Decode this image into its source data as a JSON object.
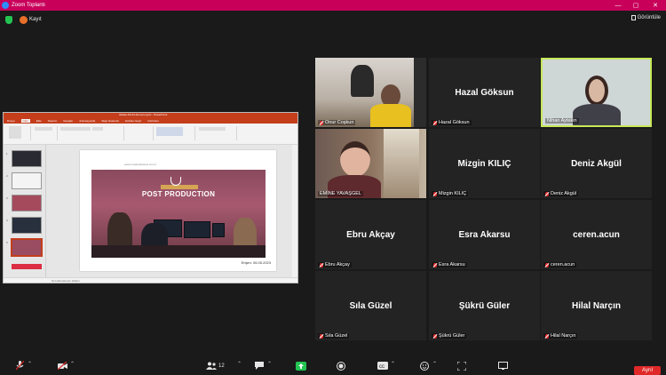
{
  "window": {
    "title": "Zoom Toplantı",
    "controls": [
      "—",
      "▢",
      "✕"
    ]
  },
  "topbar": {
    "recording_label": "Kayıt",
    "view_label": "Görüntüle"
  },
  "share": {
    "ppt_file_title": "Ailelek-Kit-04-Sunumu.pptx - PowerPoint",
    "tabs": [
      "Dosya",
      "Giriş",
      "Ekle",
      "Tasarım",
      "Geçişler",
      "Animasyonlar",
      "Slayt Gösterisi",
      "Gözden Geçir",
      "Görünüm"
    ],
    "slide_url": "www.ornekwebsitesi.com.tr",
    "slide_headline": "POST PRODUCTION",
    "slide_date": "Erişim: 06.05.2023",
    "status_text": "Not eklemek için tıklatın",
    "thumb_numbers": [
      "1",
      "2",
      "3",
      "4",
      "5"
    ]
  },
  "participants": [
    {
      "name": "Onur Coşkun",
      "display": "",
      "muted": true
    },
    {
      "name": "Hazal Göksun",
      "display": "Hazal Göksun",
      "muted": true
    },
    {
      "name": "Nihan Aytekin",
      "display": "",
      "muted": false
    },
    {
      "name": "EMİNE YAVAŞGEL",
      "display": "",
      "muted": false
    },
    {
      "name": "Mizgin KILIÇ",
      "display": "Mizgin KILIÇ",
      "muted": true
    },
    {
      "name": "Deniz Akgül",
      "display": "Deniz Akgül",
      "muted": true
    },
    {
      "name": "Ebru Akçay",
      "display": "Ebru Akçay",
      "muted": true
    },
    {
      "name": "Esra Akarsu",
      "display": "Esra Akarsu",
      "muted": true
    },
    {
      "name": "ceren.acun",
      "display": "ceren.acun",
      "muted": true
    },
    {
      "name": "Sıla Güzel",
      "display": "Sıla Güzel",
      "muted": true
    },
    {
      "name": "Şükrü Güler",
      "display": "Şükrü Güler",
      "muted": true
    },
    {
      "name": "Hilal Narçın",
      "display": "Hilal Narçın",
      "muted": true
    }
  ],
  "toolbar": {
    "participant_count": "12",
    "leave_label": "Ayrıl"
  },
  "colors": {
    "titlebar": "#c8005a",
    "active_speaker": "#c6e85a",
    "leave": "#e02828",
    "share_indicator": "#23c552"
  }
}
